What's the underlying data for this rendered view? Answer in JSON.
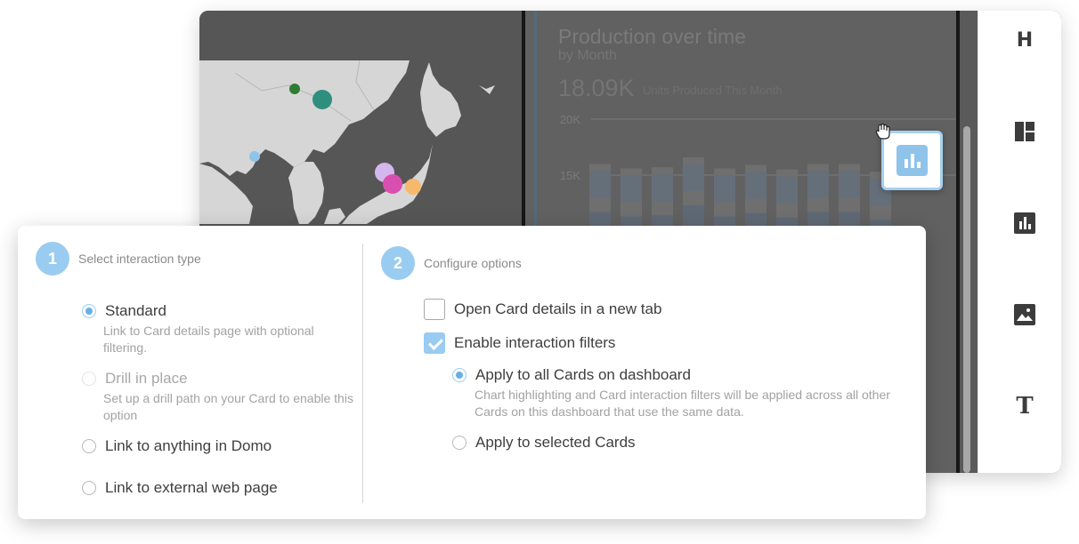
{
  "dashboard": {
    "chart": {
      "title": "Production over time",
      "subtitle": "by Month",
      "kpi_value": "18.09K",
      "kpi_label": "Units Produced This Month"
    },
    "sidebar_icons": [
      "heading-icon",
      "layout-icon",
      "bar-chart-icon",
      "image-icon",
      "text-icon"
    ]
  },
  "chart_data": {
    "type": "bar",
    "title": "Production over time",
    "subtitle": "by Month",
    "yticks": [
      "20K",
      "15K"
    ],
    "ylim": [
      0,
      20000
    ],
    "series": [
      {
        "name": "",
        "color": "#6d7f94",
        "values": [
          16000,
          15600,
          15700,
          16600,
          15600,
          15900,
          15500,
          16000,
          16000,
          15300
        ]
      }
    ]
  },
  "dialog": {
    "step1": {
      "number": "1",
      "label": "Select interaction type"
    },
    "step2": {
      "number": "2",
      "label": "Configure options"
    },
    "options": {
      "standard": {
        "label": "Standard",
        "desc": "Link to Card details page with optional filtering."
      },
      "drill": {
        "label": "Drill in place",
        "desc": "Set up a drill path on your Card to enable this option"
      },
      "link_domo": {
        "label": "Link to anything in Domo"
      },
      "link_web": {
        "label": "Link to external web page"
      }
    },
    "configure": {
      "open_new_tab": "Open Card details in a new tab",
      "enable_filters": "Enable interaction filters",
      "apply_all": "Apply to all Cards on dashboard",
      "apply_all_desc": "Chart highlighting and Card interaction filters will be applied across all other Cards on this dashboard that use the same data.",
      "apply_selected": "Apply to selected Cards"
    }
  },
  "colors": {
    "accent": "#99ccf0",
    "radio_fill": "#67b0e6",
    "map_land": "#d6d6d6",
    "map_sea": "#565656"
  }
}
